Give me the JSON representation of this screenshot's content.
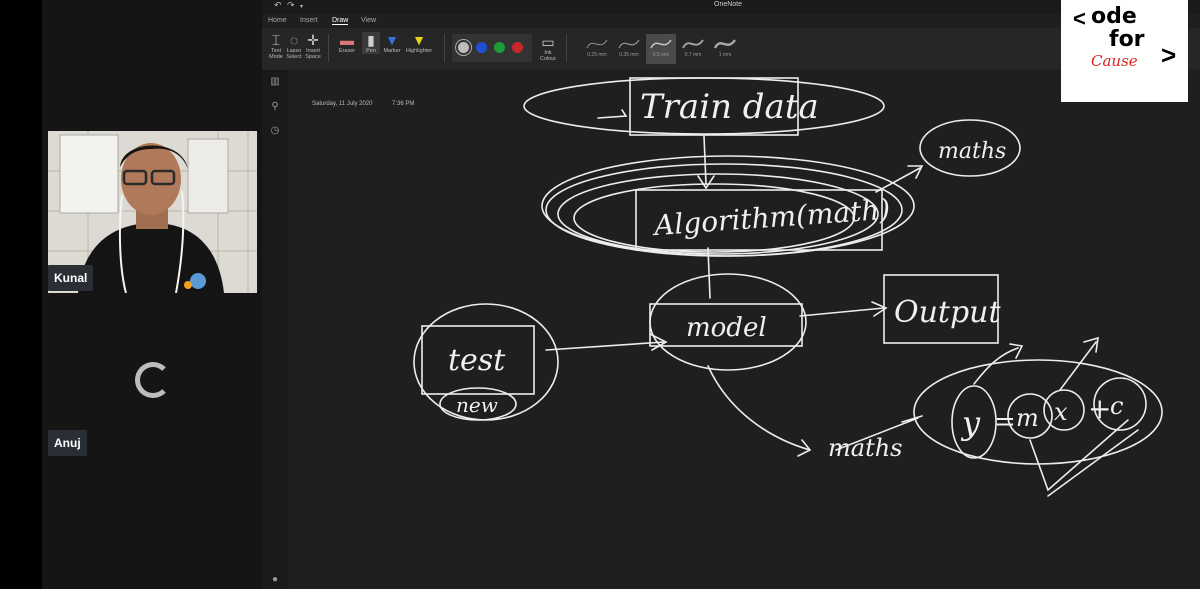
{
  "onenote": {
    "title": "OneNote",
    "tabs": [
      {
        "label": "Home"
      },
      {
        "label": "Insert"
      },
      {
        "label": "Draw"
      },
      {
        "label": "View"
      }
    ],
    "tools": {
      "text_mode": "Text Mode",
      "lasso_select": "Lasso Select",
      "insert_space": "Insert Space",
      "eraser": "Eraser",
      "pen": "Pen",
      "marker": "Marker",
      "highlighter": "Highlighter",
      "ink_colour": "Ink Colour"
    },
    "pen_colors": [
      "#bdbdbd",
      "#1f4fd6",
      "#1f9a3a",
      "#c62828"
    ],
    "thickness": [
      "0.25 mm",
      "0.35 mm",
      "0.5 mm",
      "0.7 mm",
      "1 mm"
    ],
    "page": {
      "date": "Saturday, 11 July 2020",
      "time": "7:36 PM"
    },
    "ink_text": {
      "train": "Train data",
      "algorithm": "Algorithm(math)",
      "maths_top": "maths",
      "model": "model",
      "output": "Output",
      "test": "test",
      "new": "new",
      "maths_bottom": "maths",
      "y": "y",
      "equals": "=",
      "m": "m",
      "x": "x",
      "plus": "+",
      "c": "c"
    }
  },
  "participants": [
    {
      "name": "Kunal"
    },
    {
      "name": "Anuj"
    }
  ],
  "logo": {
    "line1": "ode",
    "line2": "for",
    "line3": "Cause"
  }
}
